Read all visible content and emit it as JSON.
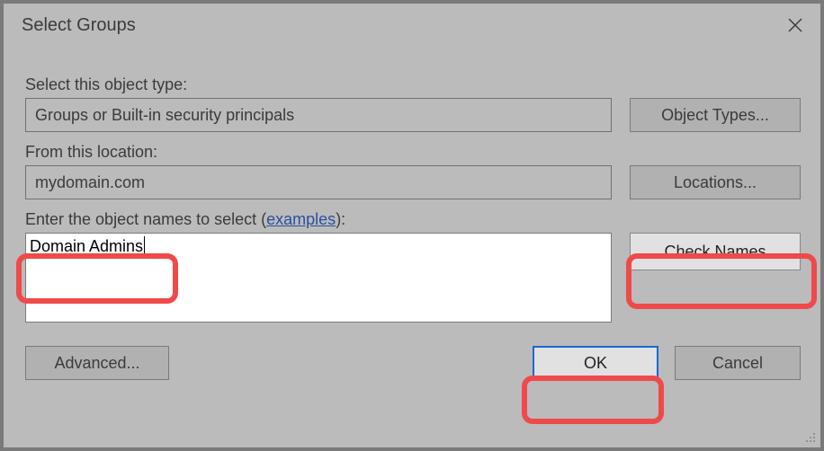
{
  "dialog": {
    "title": "Select Groups"
  },
  "labels": {
    "object_type": "Select this object type:",
    "location": "From this location:",
    "enter_names_prefix": "Enter the object names to select (",
    "enter_names_link": "examples",
    "enter_names_suffix": "):"
  },
  "fields": {
    "object_type_value": "Groups or Built-in security principals",
    "location_value": "mydomain.com",
    "names_value": "Domain Admins"
  },
  "buttons": {
    "object_types": "Object Types...",
    "locations": "Locations...",
    "check_names": "Check Names",
    "advanced": "Advanced...",
    "ok": "OK",
    "cancel": "Cancel"
  }
}
